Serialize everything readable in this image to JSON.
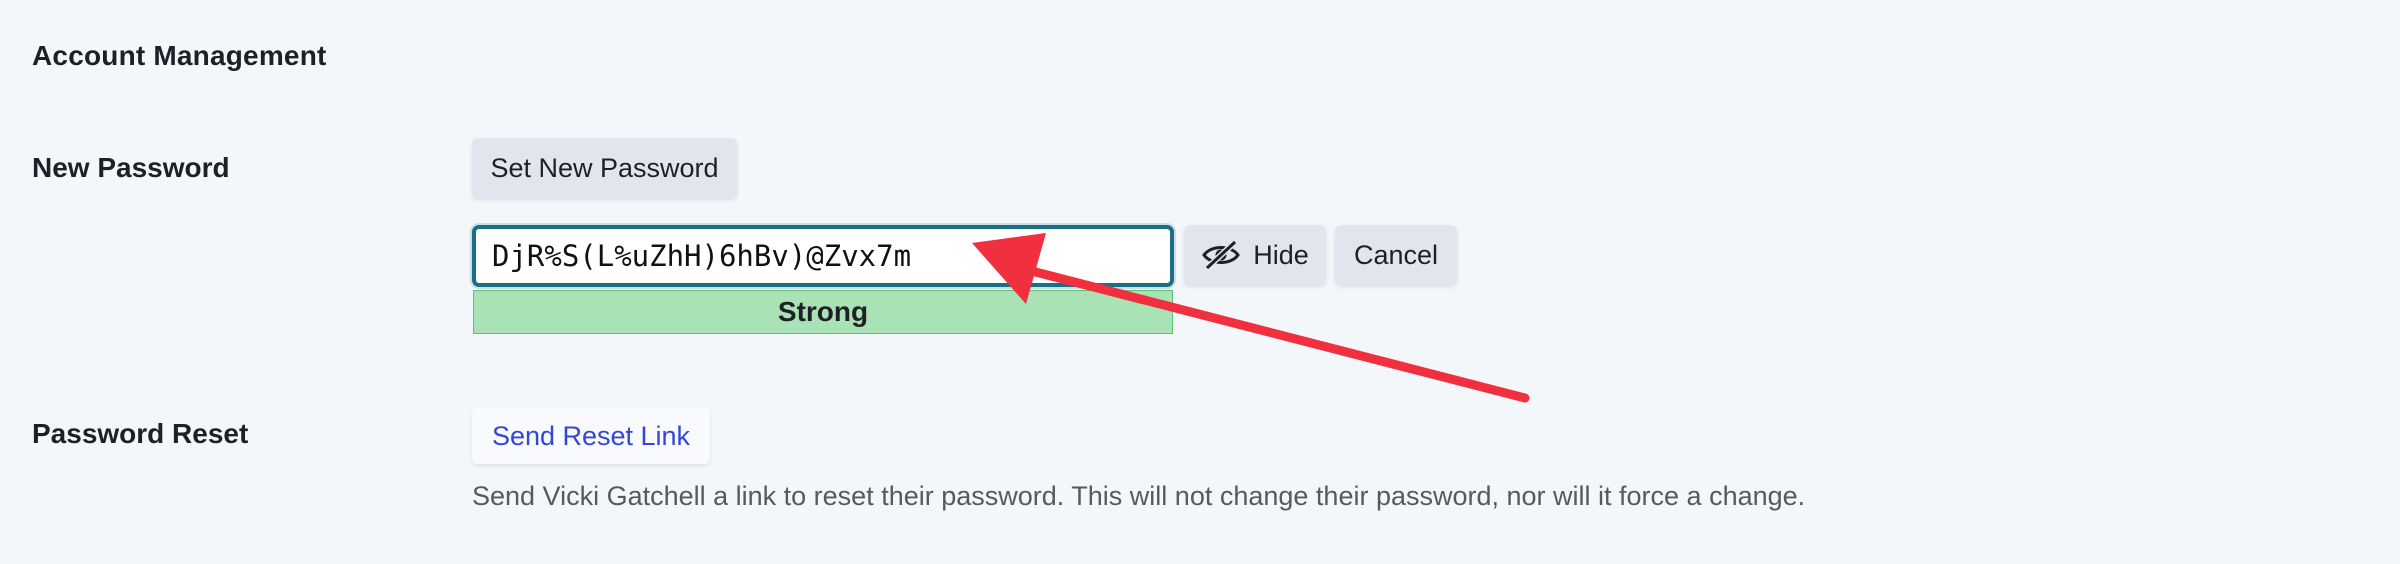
{
  "section": {
    "title": "Account Management"
  },
  "new_password": {
    "label": "New Password",
    "set_button_label": "Set New Password",
    "input_value": "DjR%S(L%uZhH)6hBv)@Zvx7m",
    "hide_button_label": "Hide",
    "cancel_button_label": "Cancel",
    "strength_label": "Strong"
  },
  "password_reset": {
    "label": "Password Reset",
    "link_label": "Send Reset Link",
    "help_text": "Send Vicki Gatchell a link to reset their password. This will not change their password, nor will it force a change."
  },
  "icons": {
    "hide_icon": "eye-slash-icon"
  },
  "colors": {
    "input_focus_border": "#1b6e86",
    "strength_strong_bg": "#a9e2b4",
    "link_text": "#3247d8",
    "annotation_arrow": "#f0303f"
  }
}
